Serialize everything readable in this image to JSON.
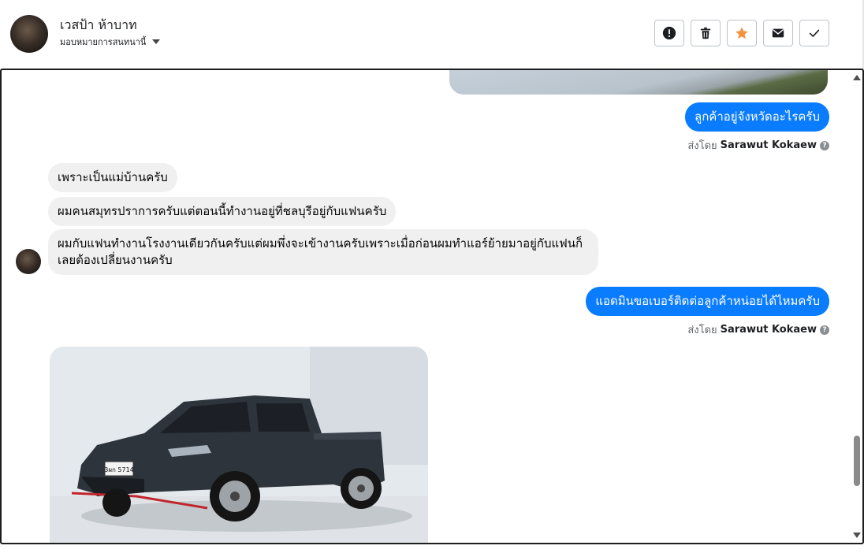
{
  "header": {
    "contact_name": "เวสป้า ห้าบาท",
    "assign_label": "มอบหมายการสนทนานี้",
    "actions": [
      {
        "name": "report-button",
        "icon": "alert-icon"
      },
      {
        "name": "delete-button",
        "icon": "trash-icon"
      },
      {
        "name": "star-button",
        "icon": "star-icon",
        "color": "#f5923e"
      },
      {
        "name": "mark-unread-button",
        "icon": "envelope-icon"
      },
      {
        "name": "mark-done-button",
        "icon": "check-icon"
      }
    ]
  },
  "messages": {
    "out_1": "ลูกค้าอยู่จังหวัดอะไรครับ",
    "in_1": "เพราะเป็นแม่บ้านครับ",
    "in_2": "ผมคนสมุทรปราการครับแต่ตอนนี้ทำงานอยู่ที่ชลบุรีอยู่กับแฟนครับ",
    "in_3": "ผมกับแฟนทำงานโรงงานเดียวกันครับแต่ผมพึ่งจะเข้างานครับเพราะเมื่อก่อนผมทำแอร์ย้ายมาอยู่กับแฟนก็เลยต้องเปลี่ยนงานครับ",
    "out_2": "แอดมินขอเบอร์ติดต่อลูกค้าหน่อยได้ไหมครับ"
  },
  "sent_by": {
    "prefix": "ส่งโดย",
    "agent": "Sarawut Kokaew"
  },
  "license_plate": "3ผก 5714",
  "colors": {
    "outgoing_bubble": "#0a7cff",
    "incoming_bubble": "#f0f0f0"
  }
}
